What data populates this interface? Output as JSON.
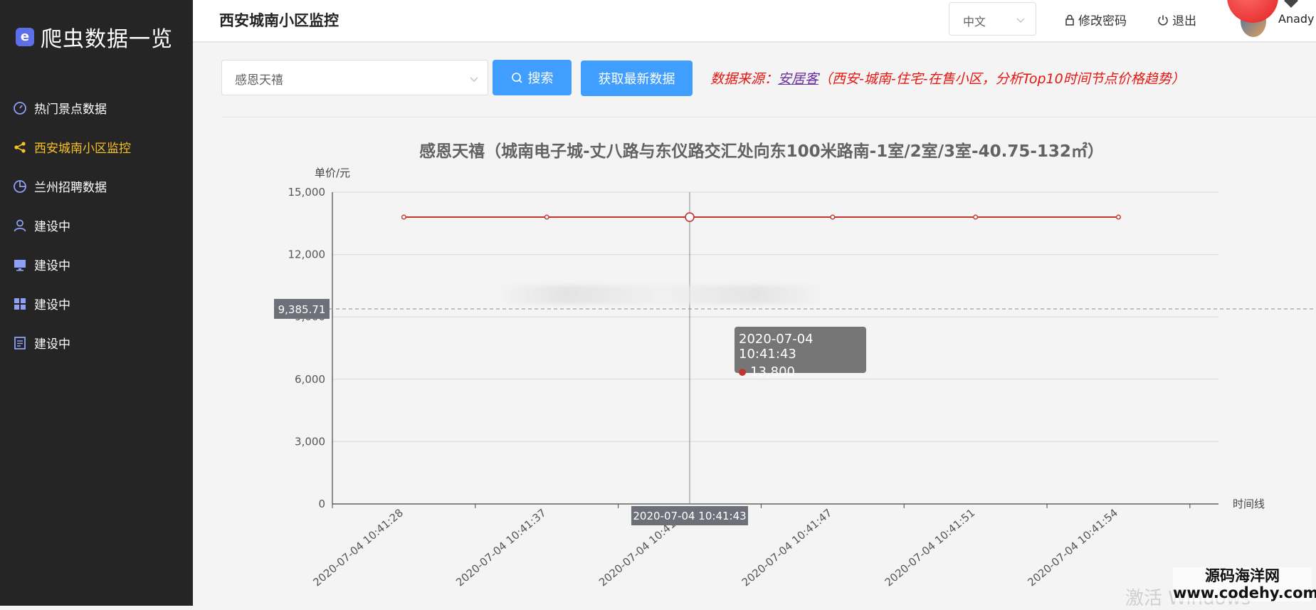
{
  "app": {
    "logo_text": "爬虫数据一览"
  },
  "sidebar": {
    "items": [
      {
        "label": "热门景点数据",
        "icon": "dashboard-icon",
        "active": false
      },
      {
        "label": "西安城南小区监控",
        "icon": "share-icon",
        "active": true
      },
      {
        "label": "兰州招聘数据",
        "icon": "pie-chart-icon",
        "active": false
      },
      {
        "label": "建设中",
        "icon": "user-icon",
        "active": false
      },
      {
        "label": "建设中",
        "icon": "monitor-icon",
        "active": false
      },
      {
        "label": "建设中",
        "icon": "grid-icon",
        "active": false
      },
      {
        "label": "建设中",
        "icon": "document-icon",
        "active": false
      }
    ]
  },
  "header": {
    "title": "西安城南小区监控",
    "language": "中文",
    "change_password": "修改密码",
    "logout": "退出",
    "username": "Anady"
  },
  "toolbar": {
    "community_select_value": "感恩天禧",
    "search_label": "搜索",
    "fetch_label": "获取最新数据",
    "source_prefix": "数据来源：",
    "source_link": "安居客",
    "source_suffix": "（西安-城南-住宅-在售小区，分析Top10时间节点价格趋势）"
  },
  "tooltip": {
    "time": "2020-07-04 10:41:43",
    "value": "13,800"
  },
  "overlay": {
    "watermark": "激活 Windows",
    "site_line1": "源码海洋网",
    "site_line2": "www.codehy.com"
  },
  "chart_data": {
    "type": "line",
    "title": "感恩天禧（城南电子城-丈八路与东仪路交汇处向东100米路南-1室/2室/3室-40.75-132㎡）",
    "ylabel": "单价/元",
    "xlabel": "时间线",
    "x": [
      "2020-07-04 10:41:28",
      "2020-07-04 10:41:37",
      "2020-07-04 10:41:43",
      "2020-07-04 10:41:47",
      "2020-07-04 10:41:51",
      "2020-07-04 10:41:54"
    ],
    "series": [
      {
        "values": [
          13800,
          13800,
          13800,
          13800,
          13800,
          13800
        ],
        "color": "#c23531"
      }
    ],
    "ylim": [
      0,
      15000
    ],
    "yticks": [
      "0",
      "3,000",
      "6,000",
      "9,000",
      "12,000",
      "15,000"
    ],
    "ytick_values": [
      0,
      3000,
      6000,
      9000,
      12000,
      15000
    ],
    "average_line": {
      "value": 9385.71,
      "label": "9,385.71"
    },
    "pointer": {
      "x": "2020-07-04 10:41:43",
      "label": "2020-07-04 10:41:43"
    },
    "grid": true
  }
}
